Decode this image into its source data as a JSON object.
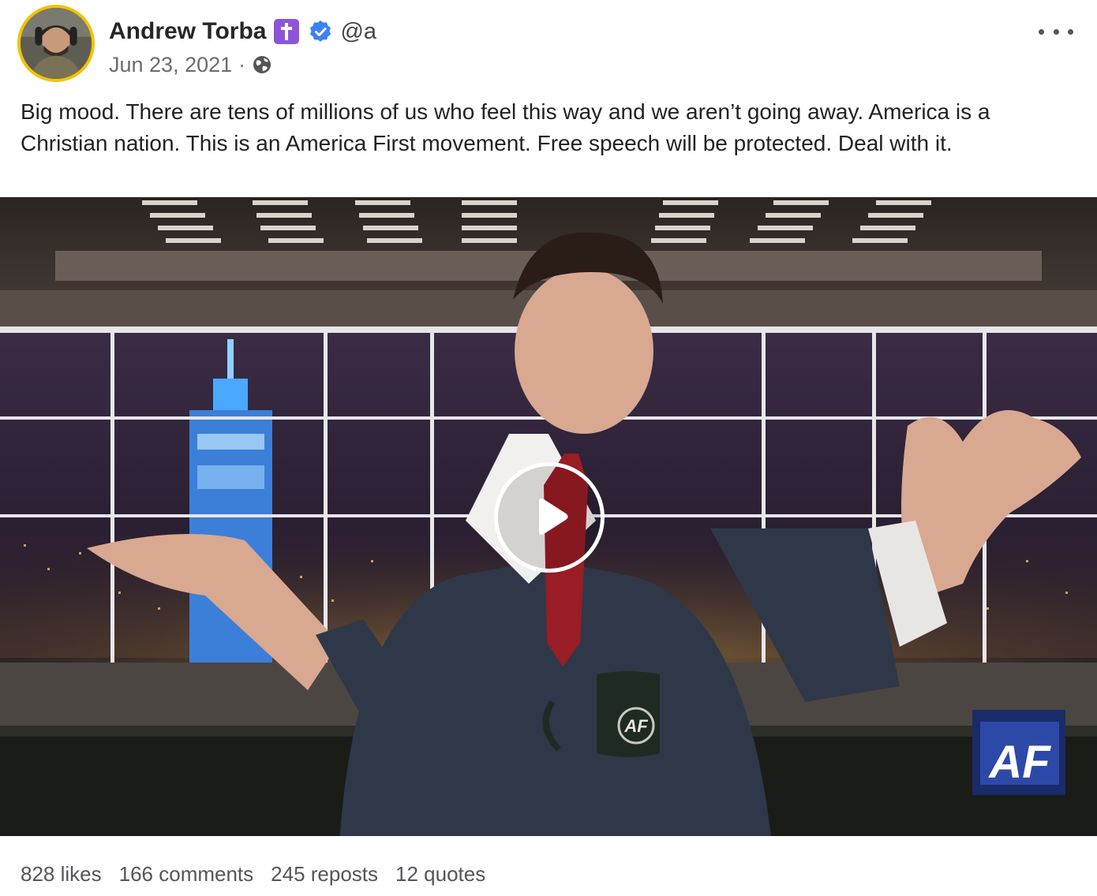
{
  "post": {
    "author": {
      "name": "Andrew Torba",
      "handle": "@a",
      "badge_icon": "cross-emoji-icon",
      "verified_icon": "verified-check-icon"
    },
    "date": "Jun 23, 2021",
    "separator": "·",
    "visibility_icon": "globe-icon",
    "more_icon": "ellipsis-icon",
    "text": "Big mood. There are tens of millions of us who feel this way and we aren’t going away. America is a Christian nation. This is an America First movement. Free speech will be protected. Deal with it.",
    "video": {
      "play_icon": "play-icon",
      "mug_logo": "AF",
      "corner_logo": "AF"
    },
    "stats": {
      "likes": "828 likes",
      "comments": "166 comments",
      "reposts": "245 reposts",
      "quotes": "12 quotes"
    }
  },
  "colors": {
    "avatar_ring": "#f2c300",
    "cross_badge": "#8c55d6",
    "verified": "#3b82f6"
  }
}
